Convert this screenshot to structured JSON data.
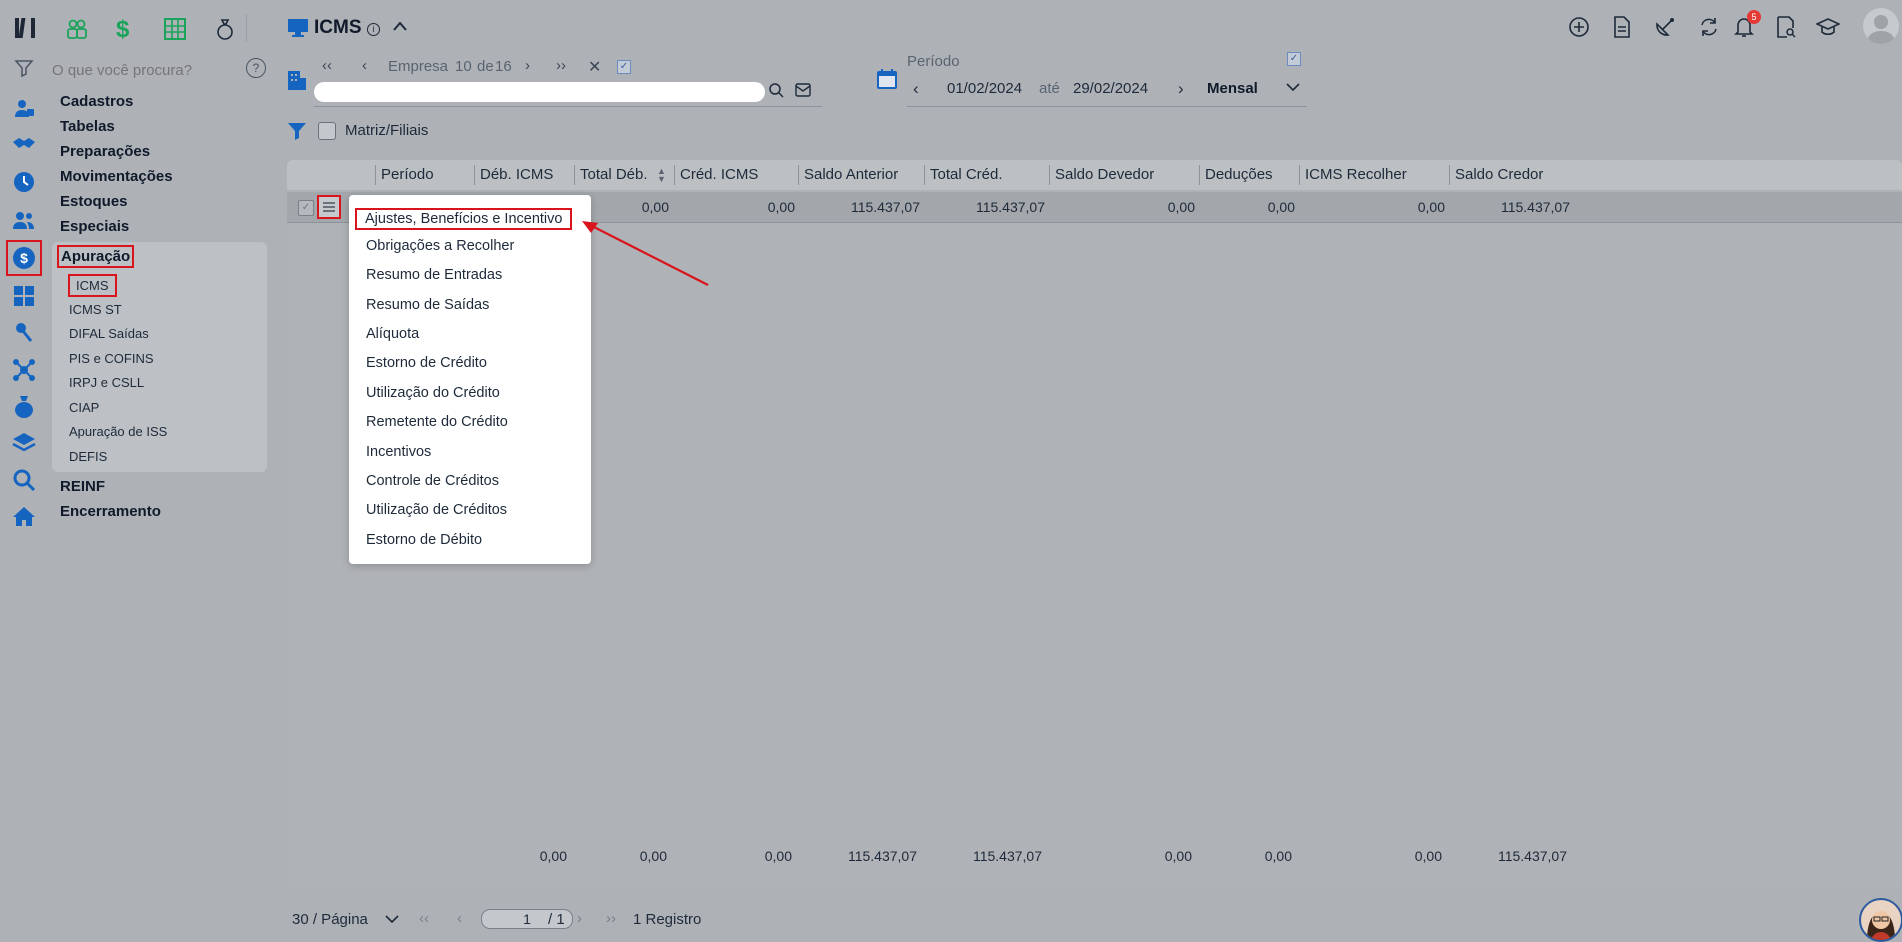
{
  "app": {
    "title": "ICMS",
    "search_placeholder": "O que você procura?",
    "help_label": "?",
    "notification_count": "5"
  },
  "sidebar": {
    "items": [
      {
        "label": "Cadastros"
      },
      {
        "label": "Tabelas"
      },
      {
        "label": "Preparações"
      },
      {
        "label": "Movimentações"
      },
      {
        "label": "Estoques"
      },
      {
        "label": "Especiais"
      },
      {
        "label": "Apuração"
      },
      {
        "label": "REINF"
      },
      {
        "label": "Encerramento"
      }
    ],
    "apuracao_sub": [
      {
        "label": "ICMS"
      },
      {
        "label": "ICMS ST"
      },
      {
        "label": "DIFAL Saídas"
      },
      {
        "label": "PIS e COFINS"
      },
      {
        "label": "IRPJ e CSLL"
      },
      {
        "label": "CIAP"
      },
      {
        "label": "Apuração de ISS"
      },
      {
        "label": "DEFIS"
      }
    ]
  },
  "toolbar": {
    "empresa_label": "Empresa",
    "empresa_current": "10",
    "empresa_of": "de",
    "empresa_total": "16",
    "periodo_label": "Período",
    "date_from": "01/02/2024",
    "date_sep": "até",
    "date_to": "29/02/2024",
    "frequency": "Mensal",
    "matriz_label": "Matriz/Filiais"
  },
  "table": {
    "columns": [
      "Período",
      "Déb. ICMS",
      "Total Déb.",
      "Créd. ICMS",
      "Saldo Anterior",
      "Total Créd.",
      "Saldo Devedor",
      "Deduções",
      "ICMS Recolher",
      "Saldo Credor"
    ],
    "row": [
      "0,00",
      "0,00",
      "115.437,07",
      "115.437,07",
      "0,00",
      "0,00",
      "0,00",
      "115.437,07"
    ],
    "totals": [
      "0,00",
      "0,00",
      "0,00",
      "115.437,07",
      "115.437,07",
      "0,00",
      "0,00",
      "0,00",
      "115.437,07"
    ]
  },
  "context_menu": {
    "items": [
      "Ajustes, Benefícios e Incentivo",
      "Obrigações a Recolher",
      "Resumo de Entradas",
      "Resumo de Saídas",
      "Alíquota",
      "Estorno de Crédito",
      "Utilização do Crédito",
      "Remetente do Crédito",
      "Incentivos",
      "Controle de Créditos",
      "Utilização de Créditos",
      "Estorno de Débito"
    ]
  },
  "pagination": {
    "per_page": "30 / Página",
    "page": "1",
    "of_pages": "/ 1",
    "records": "1 Registro"
  },
  "colors": {
    "accent": "#1565c0",
    "highlight": "#d9141c",
    "green_icon": "#1aa35a"
  }
}
